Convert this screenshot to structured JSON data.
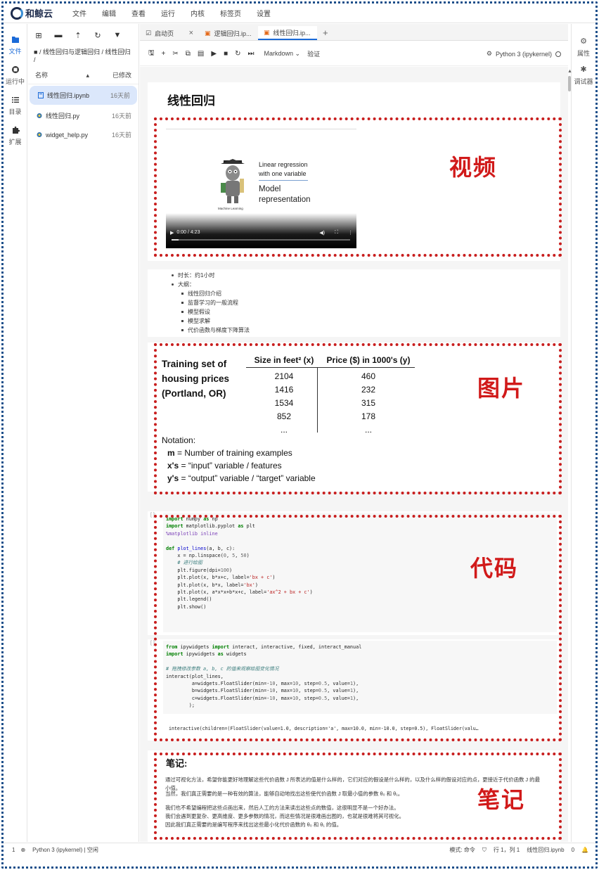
{
  "app": {
    "logo_text": "和鲸云"
  },
  "menu": [
    "文件",
    "编辑",
    "查看",
    "运行",
    "内核",
    "标签页",
    "设置"
  ],
  "activity": [
    {
      "label": "文件",
      "icon": "folder-icon",
      "active": true
    },
    {
      "label": "运行中",
      "icon": "running-icon",
      "active": false
    },
    {
      "label": "目录",
      "icon": "toc-icon",
      "active": false
    },
    {
      "label": "扩展",
      "icon": "puzzle-icon",
      "active": false
    }
  ],
  "filebrowser": {
    "path": "/ 线性回归与逻辑回归 / 线性回归 /",
    "col_name": "名称",
    "col_modified": "已修改",
    "files": [
      {
        "name": "线性回归.ipynb",
        "time": "16天前",
        "selected": true,
        "icon": "notebook-icon"
      },
      {
        "name": "线性回归.py",
        "time": "16天前",
        "selected": false,
        "icon": "python-file-icon"
      },
      {
        "name": "widget_help.py",
        "time": "16天前",
        "selected": false,
        "icon": "python-file-icon"
      }
    ]
  },
  "tabs": [
    {
      "label": "启动页",
      "active": false,
      "closable": true
    },
    {
      "label": "逻辑回归.ip...",
      "active": false,
      "closable": false
    },
    {
      "label": "线性回归.ip...",
      "active": true,
      "closable": false
    }
  ],
  "toolbar": {
    "cell_type": "Markdown",
    "validate": "验证",
    "kernel": "Python 3 (ipykernel)"
  },
  "rightbar": [
    {
      "label": "属性",
      "icon": "properties-icon"
    },
    {
      "label": "调试器",
      "icon": "debugger-icon"
    }
  ],
  "notebook": {
    "title": "线性回归",
    "labels": {
      "video": "视频",
      "image": "图片",
      "code": "代码",
      "notes": "笔记"
    },
    "video": {
      "line1": "Linear regression",
      "line2": "with one variable",
      "line3": "Model",
      "line4": "representation",
      "caption": "Machine Learning",
      "time": "0:00 / 4:23"
    },
    "bullets": {
      "duration": "时长：约1小时",
      "outline": "大纲：",
      "items": [
        "线性回归介绍",
        "监督学习的一般流程",
        "模型假设",
        "模型求解",
        "代价函数与梯度下降算法"
      ]
    },
    "image": {
      "title1": "Training set of",
      "title2": "housing prices",
      "title3": "(Portland, OR)",
      "col1": "Size in feet² (x)",
      "col2": "Price ($) in 1000's (y)",
      "sizes": [
        "2104",
        "1416",
        "1534",
        "852",
        "..."
      ],
      "prices": [
        "460",
        "232",
        "315",
        "178",
        "..."
      ],
      "notation": "Notation:",
      "m_key": "m",
      "m_text": " = Number of training examples",
      "x_key": "x's",
      "x_text": " = “input” variable / features",
      "y_key": "y's",
      "y_text": " = “output” variable / “target” variable"
    },
    "output_line": "interactive(children=(FloatSlider(value=1.0, description='a', max=10.0, min=-10.0, step=0.5), FloatSlider(valu…",
    "notes": {
      "title": "笔记:",
      "p1": "通过可视化方法，希望你能更好地理解这些代价函数 J 所表达的值是什么样的，它们对应的假设是什么样的，以及什么样的假设对应的点，更接近于代价函数 J 的最小值。",
      "p2": "当然，我们真正需要的是一种有效的算法，能够自动地找出这些使代价函数 J 取最小值的参数 θ₀ 和 θ₁。",
      "p3": "我们也不希望编程把这些点画出来，然后人工的方法来读出这些点的数值，这很明显不是一个好办法。",
      "p4": "我们会遇到更复杂、更高维度、更多参数的情况，而这些情况是很难画出图的，也就是很难将其可视化。",
      "p5": "因此我们真正需要的是编写程序来找出这些最小化代价函数的 θ₀ 和 θ₁ 的值。"
    }
  },
  "status": {
    "left_num": "1",
    "kernel": "Python 3 (ipykernel) | 空闲",
    "mode": "模式: 命令",
    "position": "行 1，列 1",
    "file": "线性回归.ipynb",
    "count": "0"
  }
}
